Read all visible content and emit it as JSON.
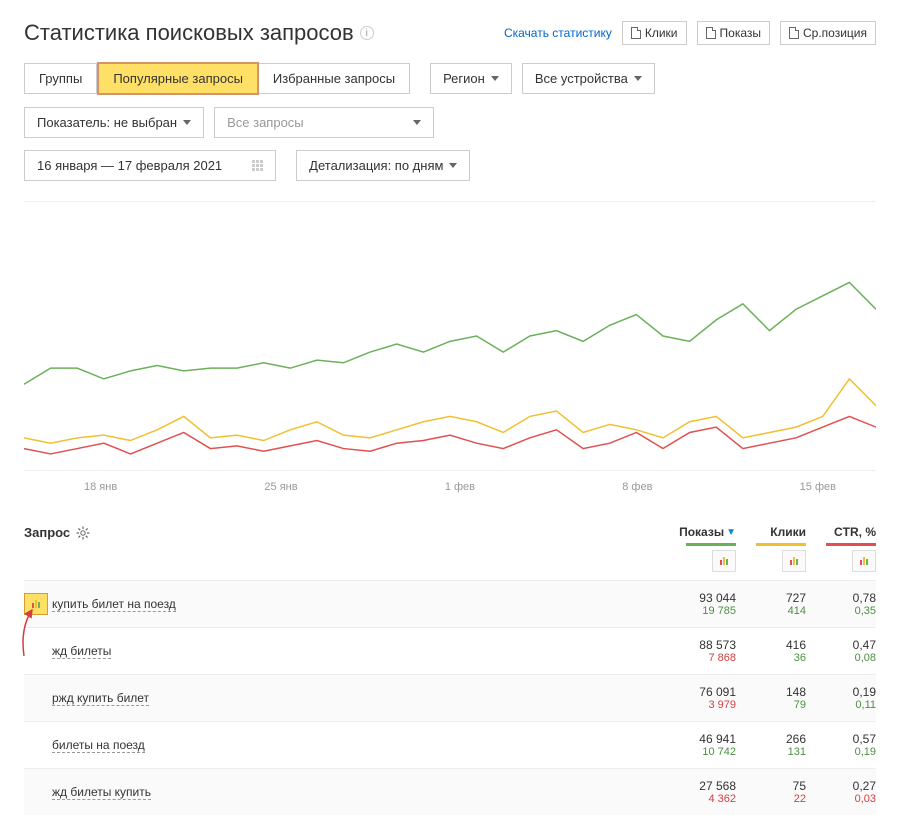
{
  "header": {
    "title": "Статистика поисковых запросов",
    "download": "Скачать статистику",
    "btn1": "Клики",
    "btn2": "Показы",
    "btn3": "Ср.позиция"
  },
  "tabs": {
    "groups": "Группы",
    "popular": "Популярные запросы",
    "favorites": "Избранные запросы"
  },
  "filters": {
    "region": "Регион",
    "devices": "Все устройства",
    "indicator": "Показатель: не выбран",
    "all_queries": "Все запросы",
    "date_range": "16 января — 17 февраля 2021",
    "detail": "Детализация: по дням"
  },
  "xaxis": [
    "18 янв",
    "25 янв",
    "1 фев",
    "8 фев",
    "15 фев"
  ],
  "table": {
    "header_query": "Запрос",
    "header_shows": "Показы",
    "header_clicks": "Клики",
    "header_ctr": "CTR, %"
  },
  "rows": [
    {
      "q": "купить билет на поезд",
      "shows": "93 044",
      "shows_sub": "19 785",
      "shows_cls": "sub-green",
      "clicks": "727",
      "clicks_sub": "414",
      "clicks_cls": "sub-green",
      "ctr": "0,78",
      "ctr_sub": "0,35",
      "ctr_cls": "sub-green",
      "active": true
    },
    {
      "q": "жд билеты",
      "shows": "88 573",
      "shows_sub": "7 868",
      "shows_cls": "sub-red",
      "clicks": "416",
      "clicks_sub": "36",
      "clicks_cls": "sub-green",
      "ctr": "0,47",
      "ctr_sub": "0,08",
      "ctr_cls": "sub-green",
      "active": false
    },
    {
      "q": "ржд купить билет",
      "shows": "76 091",
      "shows_sub": "3 979",
      "shows_cls": "sub-red",
      "clicks": "148",
      "clicks_sub": "79",
      "clicks_cls": "sub-green",
      "ctr": "0,19",
      "ctr_sub": "0,11",
      "ctr_cls": "sub-green",
      "active": false
    },
    {
      "q": "билеты на поезд",
      "shows": "46 941",
      "shows_sub": "10 742",
      "shows_cls": "sub-green",
      "clicks": "266",
      "clicks_sub": "131",
      "clicks_cls": "sub-green",
      "ctr": "0,57",
      "ctr_sub": "0,19",
      "ctr_cls": "sub-green",
      "active": false
    },
    {
      "q": "жд билеты купить",
      "shows": "27 568",
      "shows_sub": "4 362",
      "shows_cls": "sub-red",
      "clicks": "75",
      "clicks_sub": "22",
      "clicks_cls": "sub-red",
      "ctr": "0,27",
      "ctr_sub": "0,03",
      "ctr_cls": "sub-red",
      "active": false
    }
  ],
  "chart_data": {
    "type": "line",
    "x_ticks": [
      "18 янв",
      "25 янв",
      "1 фев",
      "8 фев",
      "15 фев"
    ],
    "series": [
      {
        "name": "Показы",
        "color": "#6bb05a",
        "values": [
          68,
          62,
          62,
          66,
          63,
          61,
          63,
          62,
          62,
          60,
          62,
          59,
          60,
          56,
          53,
          56,
          52,
          50,
          56,
          50,
          48,
          52,
          46,
          42,
          50,
          52,
          44,
          38,
          48,
          40,
          35,
          30,
          40
        ]
      },
      {
        "name": "Клики",
        "color": "#f0c030",
        "values": [
          88,
          90,
          88,
          87,
          89,
          85,
          80,
          88,
          87,
          89,
          85,
          82,
          87,
          88,
          85,
          82,
          80,
          82,
          86,
          80,
          78,
          86,
          83,
          85,
          88,
          82,
          80,
          88,
          86,
          84,
          80,
          66,
          76
        ]
      },
      {
        "name": "CTR",
        "color": "#e05050",
        "values": [
          92,
          94,
          92,
          90,
          94,
          90,
          86,
          92,
          91,
          93,
          91,
          89,
          92,
          93,
          90,
          89,
          87,
          90,
          92,
          88,
          85,
          92,
          90,
          86,
          92,
          86,
          84,
          92,
          90,
          88,
          84,
          80,
          84
        ]
      }
    ]
  }
}
